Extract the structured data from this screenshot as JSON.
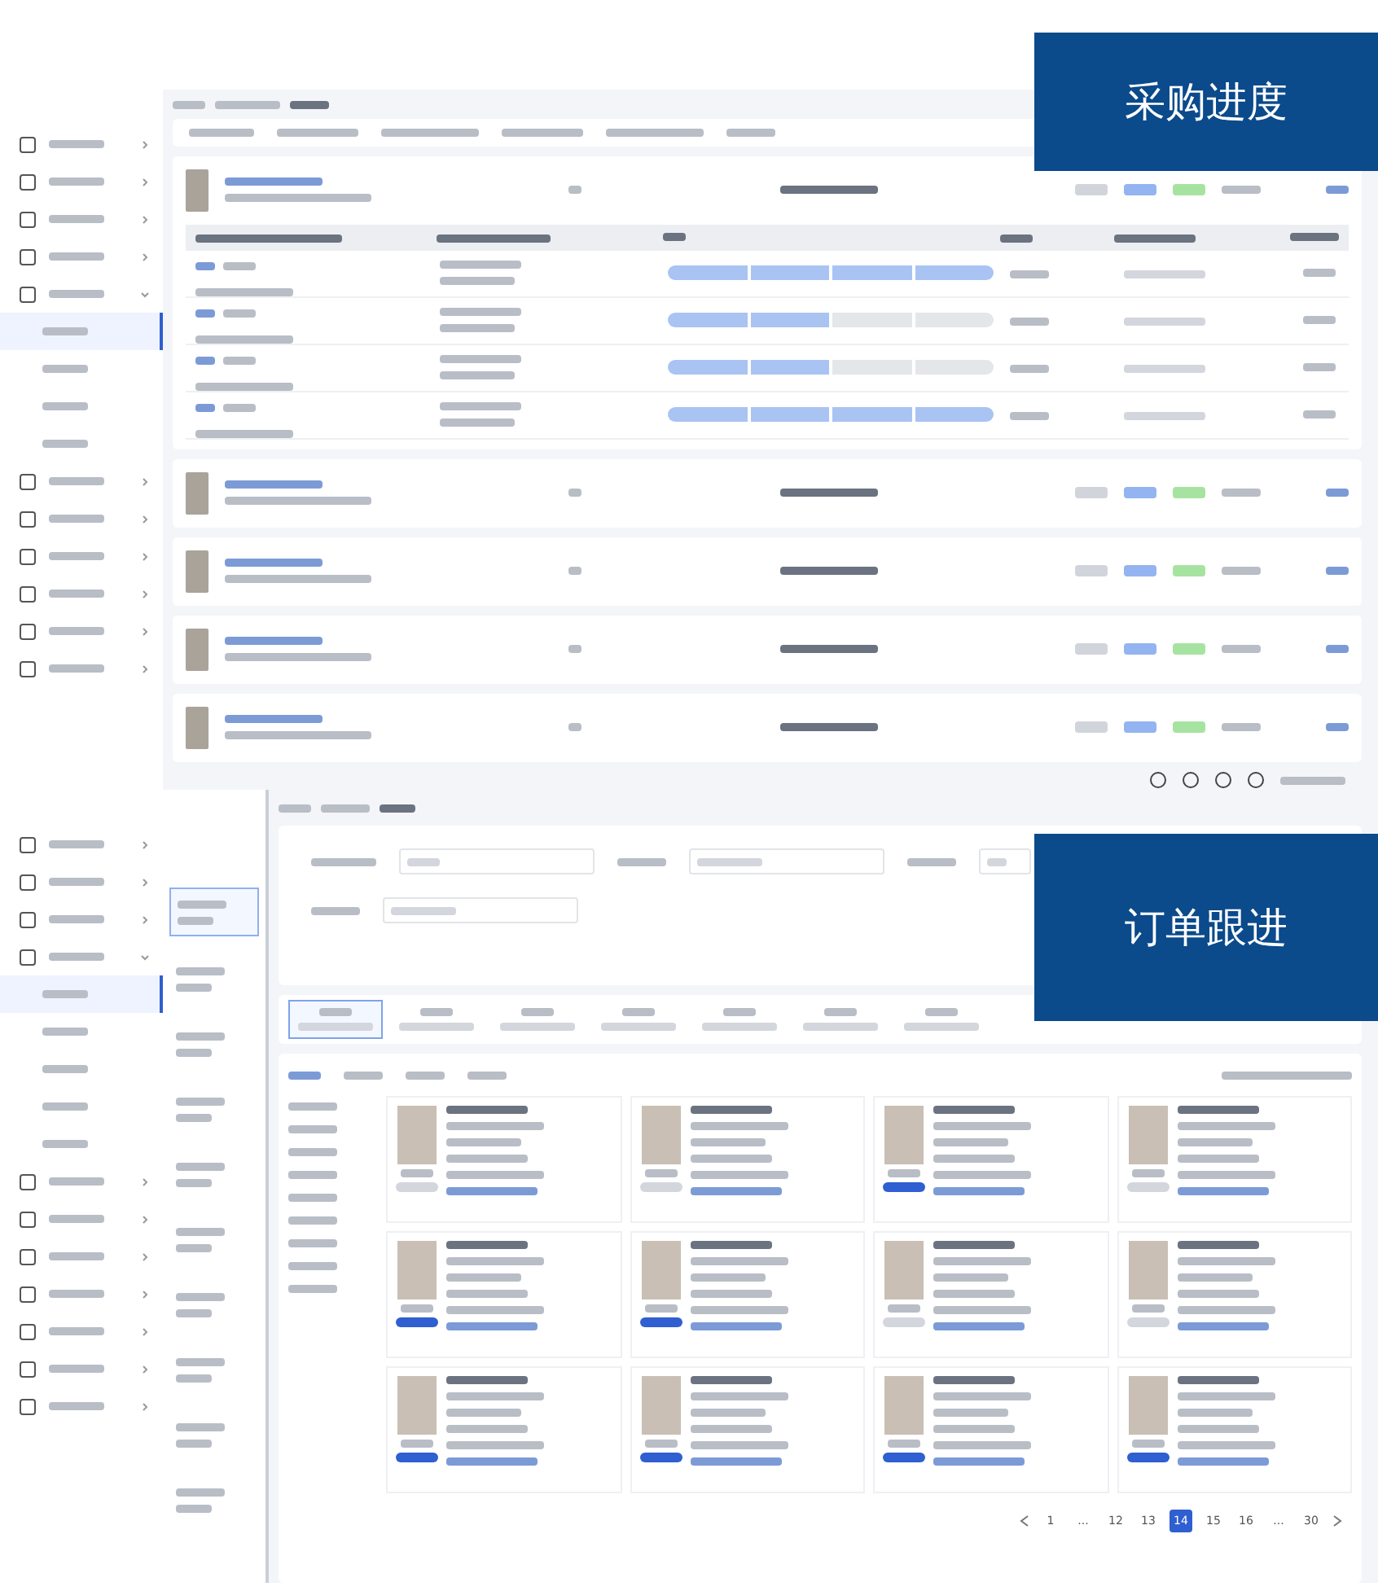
{
  "purchase_progress": {
    "label": "采购进度",
    "sidebar_items": [
      {
        "selected": false,
        "expanded": false
      },
      {
        "selected": false,
        "expanded": false
      },
      {
        "selected": false,
        "expanded": false
      },
      {
        "selected": false,
        "expanded": false
      },
      {
        "selected": false,
        "expanded": true,
        "children": [
          {
            "selected": true
          },
          {
            "selected": false
          },
          {
            "selected": false
          },
          {
            "selected": false
          }
        ]
      },
      {
        "selected": false,
        "expanded": false
      },
      {
        "selected": false,
        "expanded": false
      },
      {
        "selected": false,
        "expanded": false
      },
      {
        "selected": false,
        "expanded": false
      },
      {
        "selected": false,
        "expanded": false
      },
      {
        "selected": false,
        "expanded": false
      }
    ],
    "orders": [
      {
        "expanded": true,
        "lines": [
          {
            "steps": [
              {
                "done": true
              },
              {
                "done": true
              },
              {
                "done": true
              },
              {
                "done": true
              }
            ]
          },
          {
            "steps": [
              {
                "done": true
              },
              {
                "done": true
              },
              {
                "done": false
              },
              {
                "done": false
              }
            ]
          },
          {
            "steps": [
              {
                "done": true
              },
              {
                "done": true
              },
              {
                "done": false
              },
              {
                "done": false
              }
            ]
          },
          {
            "steps": [
              {
                "done": true
              },
              {
                "done": true
              },
              {
                "done": true
              },
              {
                "done": true
              }
            ]
          }
        ]
      },
      {
        "expanded": false
      },
      {
        "expanded": false
      },
      {
        "expanded": false
      },
      {
        "expanded": false
      }
    ]
  },
  "order_follow_up": {
    "label": "订单跟进",
    "sidebar_items": [
      {
        "selected": false,
        "expanded": false
      },
      {
        "selected": false,
        "expanded": false
      },
      {
        "selected": false,
        "expanded": false
      },
      {
        "selected": false,
        "expanded": true,
        "children": [
          {
            "selected": true
          },
          {
            "selected": false
          },
          {
            "selected": false
          },
          {
            "selected": false
          },
          {
            "selected": false
          }
        ]
      },
      {
        "selected": false,
        "expanded": false
      },
      {
        "selected": false,
        "expanded": false
      },
      {
        "selected": false,
        "expanded": false
      },
      {
        "selected": false,
        "expanded": false
      },
      {
        "selected": false,
        "expanded": false
      },
      {
        "selected": false,
        "expanded": false
      },
      {
        "selected": false,
        "expanded": false
      }
    ],
    "tabs": [
      {
        "selected": true
      },
      {
        "selected": false
      },
      {
        "selected": false
      },
      {
        "selected": false
      },
      {
        "selected": false
      },
      {
        "selected": false
      },
      {
        "selected": false
      }
    ],
    "products": [
      {
        "highlighted": false
      },
      {
        "highlighted": false
      },
      {
        "highlighted": true
      },
      {
        "highlighted": false
      },
      {
        "highlighted": true
      },
      {
        "highlighted": true
      },
      {
        "highlighted": false
      },
      {
        "highlighted": false
      },
      {
        "highlighted": true
      },
      {
        "highlighted": true
      },
      {
        "highlighted": true
      },
      {
        "highlighted": true
      }
    ],
    "pagination": [
      {
        "label": "1",
        "selected": false
      },
      {
        "label": "...",
        "selected": false
      },
      {
        "label": "12",
        "selected": false
      },
      {
        "label": "13",
        "selected": false
      },
      {
        "label": "14",
        "selected": true
      },
      {
        "label": "15",
        "selected": false
      },
      {
        "label": "16",
        "selected": false
      },
      {
        "label": "...",
        "selected": false
      },
      {
        "label": "30",
        "selected": false
      }
    ]
  }
}
